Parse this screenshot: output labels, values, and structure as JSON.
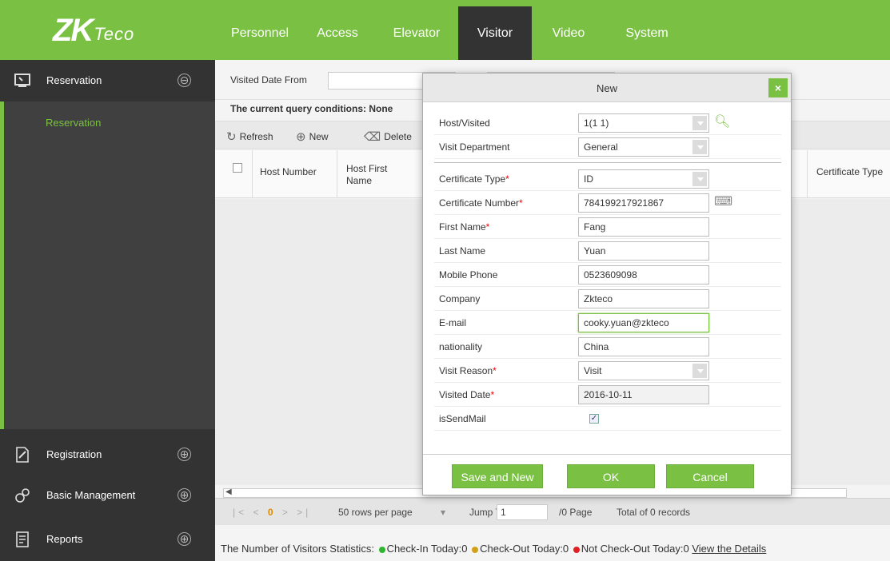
{
  "brand": {
    "logo_main": "ZK",
    "logo_sub": "Teco"
  },
  "nav": [
    "Personnel",
    "Access",
    "Elevator",
    "Visitor",
    "Video",
    "System"
  ],
  "sidebar": {
    "reservation": {
      "label": "Reservation",
      "toggle": "⊖",
      "sub_item": "Reservation"
    },
    "registration": {
      "label": "Registration",
      "toggle": "⊕"
    },
    "basic": {
      "label": "Basic Management",
      "toggle": "⊕"
    },
    "reports": {
      "label": "Reports",
      "toggle": "⊕"
    }
  },
  "filter": {
    "label": "Visited Date From",
    "query_conditions": "The current query conditions: None"
  },
  "toolbar": {
    "refresh": "Refresh",
    "new": "New",
    "delete": "Delete"
  },
  "grid": {
    "col_host_number": "Host Number",
    "col_host_first_1": "Host First",
    "col_host_first_2": "Name",
    "col_cert_type": "Certificate Type"
  },
  "pager": {
    "current": "0",
    "rows_per_page": "50 rows per page",
    "jump_label": "Jump To",
    "jump_value": "1",
    "pages": "/0 Page",
    "total": "Total of 0 records"
  },
  "status": {
    "prefix": "The Number of Visitors Statistics:",
    "checkin": "Check-In Today:0",
    "checkout": "Check-Out Today:0",
    "notcheckout": "Not Check-Out Today:0",
    "link": "View the Details",
    "colors": {
      "checkin": "#2fb52f",
      "checkout": "#d4a017",
      "notcheckout": "#e02020"
    }
  },
  "modal": {
    "title": "New",
    "close": "×",
    "fields": {
      "host_visited": {
        "label": "Host/Visited",
        "value": "1(1 1)"
      },
      "visit_department": {
        "label": "Visit Department",
        "value": "General"
      },
      "certificate_type": {
        "label": "Certificate Type",
        "value": "ID"
      },
      "certificate_number": {
        "label": "Certificate Number",
        "value": "784199217921867"
      },
      "first_name": {
        "label": "First Name",
        "value": "Fang"
      },
      "last_name": {
        "label": "Last Name",
        "value": "Yuan"
      },
      "mobile_phone": {
        "label": "Mobile Phone",
        "value": "0523609098"
      },
      "company": {
        "label": "Company",
        "value": "Zkteco"
      },
      "email": {
        "label": "E-mail",
        "value": "cooky.yuan@zkteco"
      },
      "nationality": {
        "label": "nationality",
        "value": "China"
      },
      "visit_reason": {
        "label": "Visit Reason",
        "value": "Visit"
      },
      "visited_date": {
        "label": "Visited Date",
        "value": "2016-10-11"
      },
      "is_send_mail": {
        "label": "isSendMail",
        "checked": "✓"
      }
    },
    "required_mark": "*",
    "buttons": {
      "save_new": "Save and New",
      "ok": "OK",
      "cancel": "Cancel"
    }
  }
}
